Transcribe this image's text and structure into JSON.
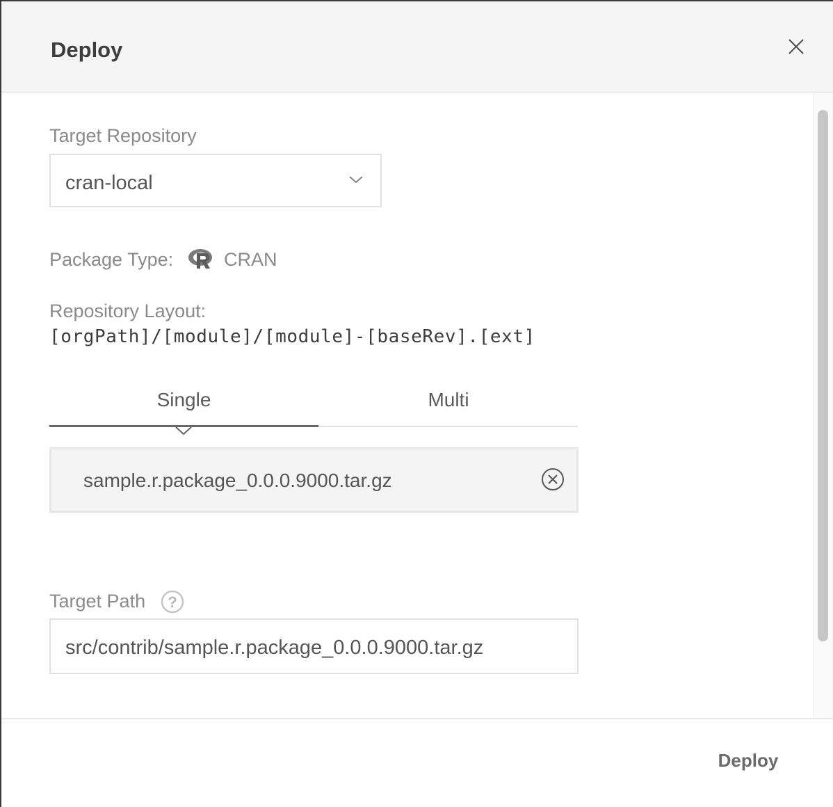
{
  "dialog": {
    "title": "Deploy",
    "close_icon": "close-icon"
  },
  "form": {
    "target_repository_label": "Target Repository",
    "target_repository_value": "cran-local",
    "package_type_label": "Package Type:",
    "package_type_icon": "r-language-icon",
    "package_type_value": "CRAN",
    "repository_layout_label": "Repository Layout:",
    "repository_layout_value": "[orgPath]/[module]/[module]-[baseRev].[ext]",
    "tabs": [
      {
        "label": "Single",
        "active": true
      },
      {
        "label": "Multi",
        "active": false
      }
    ],
    "file_name": "sample.r.package_0.0.0.9000.tar.gz",
    "target_path_label": "Target Path",
    "target_path_value": "src/contrib/sample.r.package_0.0.0.9000.tar.gz"
  },
  "footer": {
    "deploy_label": "Deploy"
  },
  "colors": {
    "header_bg": "#f5f5f5",
    "text_dark": "#3d3d3d",
    "text_muted": "#8a8a8a",
    "border": "#e1e1e1"
  }
}
